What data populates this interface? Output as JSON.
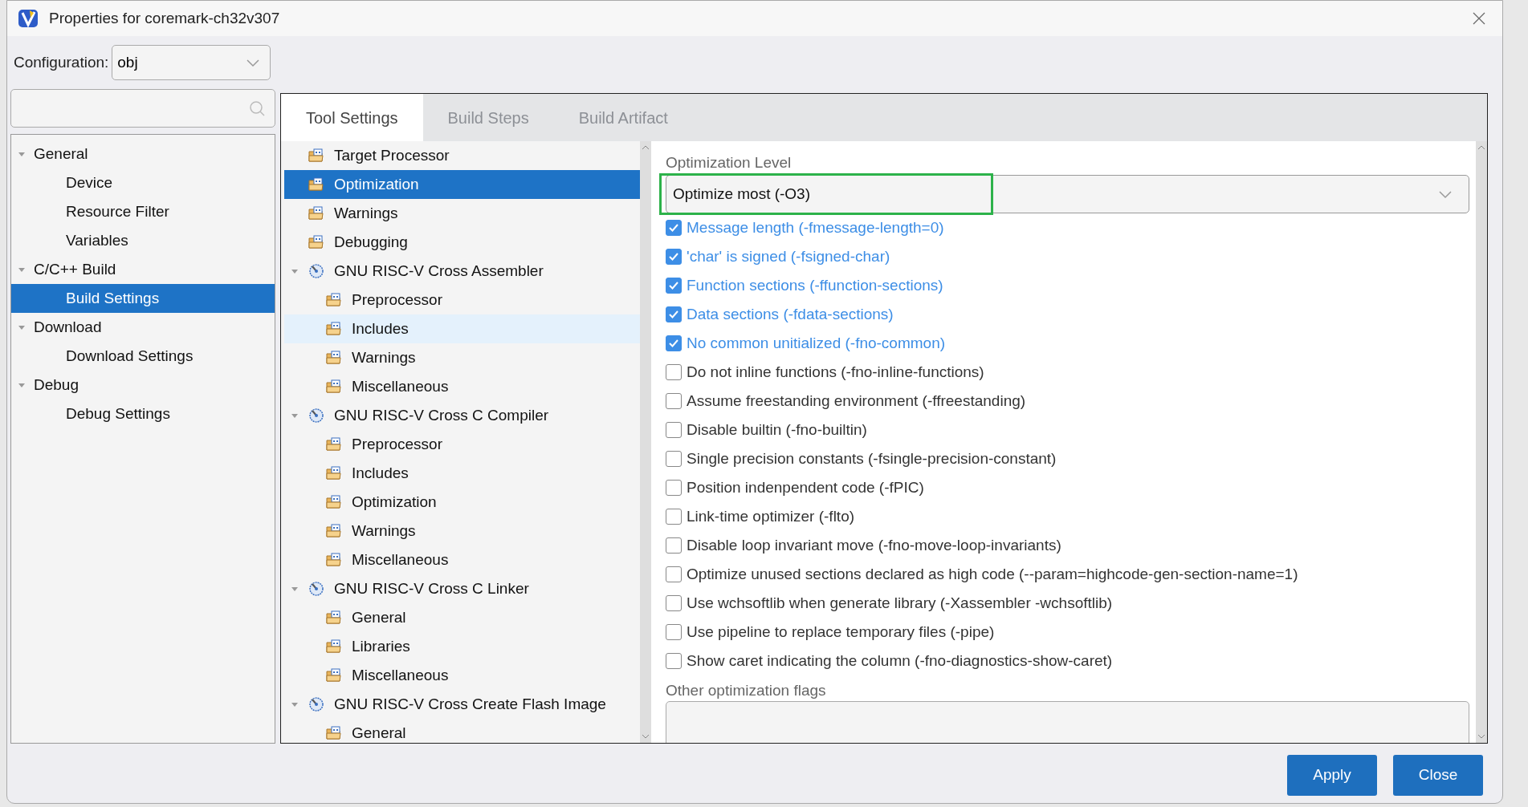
{
  "window": {
    "title": "Properties for coremark-ch32v307"
  },
  "configuration": {
    "label": "Configuration:",
    "value": "obj"
  },
  "sidebar": {
    "items": [
      {
        "label": "General",
        "expanded": true,
        "selected": false,
        "children": [
          {
            "label": "Device",
            "selected": false
          },
          {
            "label": "Resource Filter",
            "selected": false
          },
          {
            "label": "Variables",
            "selected": false
          }
        ]
      },
      {
        "label": "C/C++ Build",
        "expanded": true,
        "selected": false,
        "children": [
          {
            "label": "Build Settings",
            "selected": true
          }
        ]
      },
      {
        "label": "Download",
        "expanded": true,
        "selected": false,
        "children": [
          {
            "label": "Download Settings",
            "selected": false
          }
        ]
      },
      {
        "label": "Debug",
        "expanded": true,
        "selected": false,
        "children": [
          {
            "label": "Debug Settings",
            "selected": false
          }
        ]
      }
    ]
  },
  "tabs": [
    {
      "label": "Tool Settings",
      "selected": true
    },
    {
      "label": "Build Steps",
      "selected": false
    },
    {
      "label": "Build Artifact",
      "selected": false
    }
  ],
  "tool_tree": [
    {
      "kind": "folder",
      "label": "Target Processor",
      "selected": false,
      "hovered": false
    },
    {
      "kind": "folder",
      "label": "Optimization",
      "selected": true,
      "hovered": false
    },
    {
      "kind": "folder",
      "label": "Warnings",
      "selected": false,
      "hovered": false
    },
    {
      "kind": "folder",
      "label": "Debugging",
      "selected": false,
      "hovered": false
    },
    {
      "kind": "tool",
      "label": "GNU RISC-V Cross Assembler",
      "selected": false,
      "hovered": false,
      "expanded": true,
      "children": [
        {
          "kind": "folder",
          "label": "Preprocessor",
          "selected": false,
          "hovered": false
        },
        {
          "kind": "folder",
          "label": "Includes",
          "selected": false,
          "hovered": true
        },
        {
          "kind": "folder",
          "label": "Warnings",
          "selected": false,
          "hovered": false
        },
        {
          "kind": "folder",
          "label": "Miscellaneous",
          "selected": false,
          "hovered": false
        }
      ]
    },
    {
      "kind": "tool",
      "label": "GNU RISC-V Cross C Compiler",
      "selected": false,
      "hovered": false,
      "expanded": true,
      "children": [
        {
          "kind": "folder",
          "label": "Preprocessor",
          "selected": false,
          "hovered": false
        },
        {
          "kind": "folder",
          "label": "Includes",
          "selected": false,
          "hovered": false
        },
        {
          "kind": "folder",
          "label": "Optimization",
          "selected": false,
          "hovered": false
        },
        {
          "kind": "folder",
          "label": "Warnings",
          "selected": false,
          "hovered": false
        },
        {
          "kind": "folder",
          "label": "Miscellaneous",
          "selected": false,
          "hovered": false
        }
      ]
    },
    {
      "kind": "tool",
      "label": "GNU RISC-V Cross C Linker",
      "selected": false,
      "hovered": false,
      "expanded": true,
      "children": [
        {
          "kind": "folder",
          "label": "General",
          "selected": false,
          "hovered": false
        },
        {
          "kind": "folder",
          "label": "Libraries",
          "selected": false,
          "hovered": false
        },
        {
          "kind": "folder",
          "label": "Miscellaneous",
          "selected": false,
          "hovered": false
        }
      ]
    },
    {
      "kind": "tool",
      "label": "GNU RISC-V Cross Create Flash Image",
      "selected": false,
      "hovered": false,
      "expanded": true,
      "children": [
        {
          "kind": "folder",
          "label": "General",
          "selected": false,
          "hovered": false
        }
      ]
    }
  ],
  "optimization": {
    "level": {
      "label": "Optimization Level",
      "value": "Optimize most (-O3)",
      "highlighted": true
    },
    "options": [
      {
        "label": "Message length (-fmessage-length=0)",
        "checked": true
      },
      {
        "label": "'char' is signed (-fsigned-char)",
        "checked": true
      },
      {
        "label": "Function sections (-ffunction-sections)",
        "checked": true
      },
      {
        "label": "Data sections (-fdata-sections)",
        "checked": true
      },
      {
        "label": "No common unitialized (-fno-common)",
        "checked": true
      },
      {
        "label": "Do not inline functions (-fno-inline-functions)",
        "checked": false
      },
      {
        "label": "Assume freestanding environment (-ffreestanding)",
        "checked": false
      },
      {
        "label": "Disable builtin (-fno-builtin)",
        "checked": false
      },
      {
        "label": "Single precision constants (-fsingle-precision-constant)",
        "checked": false
      },
      {
        "label": "Position indenpendent code (-fPIC)",
        "checked": false
      },
      {
        "label": "Link-time optimizer (-flto)",
        "checked": false
      },
      {
        "label": "Disable loop invariant move (-fno-move-loop-invariants)",
        "checked": false
      },
      {
        "label": "Optimize unused sections declared as high code (--param=highcode-gen-section-name=1)",
        "checked": false
      },
      {
        "label": "Use wchsoftlib when generate library (-Xassembler -wchsoftlib)",
        "checked": false
      },
      {
        "label": "Use pipeline to replace temporary files (-pipe)",
        "checked": false
      },
      {
        "label": "Show caret indicating the column (-fno-diagnostics-show-caret)",
        "checked": false
      }
    ],
    "other_flags": {
      "label": "Other optimization flags"
    }
  },
  "buttons": [
    {
      "label": "Apply"
    },
    {
      "label": "Close"
    }
  ]
}
